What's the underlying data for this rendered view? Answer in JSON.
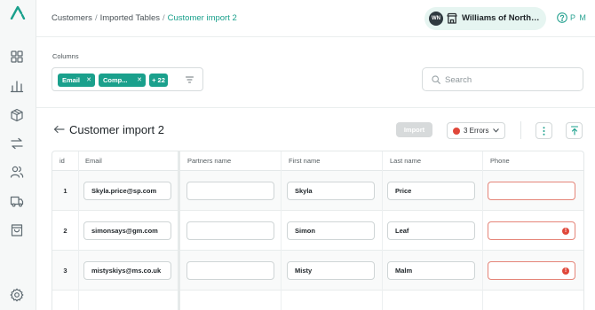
{
  "app": {
    "brand_color": "#1aa08c",
    "error_color": "#e0473a"
  },
  "sidebar": {
    "items": [
      {
        "icon": "dashboard-grid-icon"
      },
      {
        "icon": "bar-chart-icon"
      },
      {
        "icon": "box-icon"
      },
      {
        "icon": "transfer-arrows-icon"
      },
      {
        "icon": "users-icon"
      },
      {
        "icon": "truck-icon"
      },
      {
        "icon": "shopping-bag-icon"
      },
      {
        "icon": "settings-gear-icon"
      }
    ]
  },
  "header": {
    "breadcrumb": {
      "items": [
        "Customers",
        "Imported Tables"
      ],
      "current": "Customer import 2",
      "separator": "/"
    },
    "org": {
      "initials": "WN",
      "name": "Williams of Northampton"
    },
    "user_initials": "P M"
  },
  "filters": {
    "columns_label": "Columns",
    "chips": [
      "Email",
      "Comp..."
    ],
    "more_count": "+ 22",
    "search_placeholder": "Search"
  },
  "toolbar": {
    "title": "Customer import 2",
    "import_label": "Import",
    "errors_label": "3 Errors"
  },
  "table": {
    "columns": [
      "id",
      "Email",
      "Partners name",
      "First name",
      "Last name",
      "Phone"
    ],
    "rows": [
      {
        "id": "1",
        "email": "Skyla.price@sp.com",
        "partners_name": "",
        "first_name": "Skyla",
        "last_name": "Price",
        "phone": "",
        "phone_error": true,
        "phone_badge": false
      },
      {
        "id": "2",
        "email": "simonsays@gm.com",
        "partners_name": "",
        "first_name": "Simon",
        "last_name": "Leaf",
        "phone": "",
        "phone_error": true,
        "phone_badge": true
      },
      {
        "id": "3",
        "email": "mistyskiys@ms.co.uk",
        "partners_name": "",
        "first_name": "Misty",
        "last_name": "Malm",
        "phone": "",
        "phone_error": true,
        "phone_badge": true
      }
    ]
  }
}
